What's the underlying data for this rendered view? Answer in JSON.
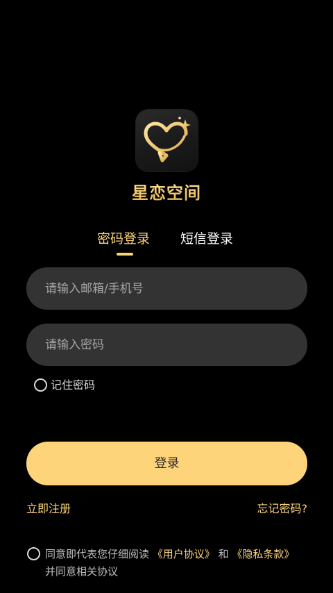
{
  "app": {
    "name": "星恋空间",
    "logo_icon": "heart-star-icon"
  },
  "tabs": [
    {
      "label": "密码登录",
      "active": true
    },
    {
      "label": "短信登录",
      "active": false
    }
  ],
  "form": {
    "account_placeholder": "请输入邮箱/手机号",
    "password_placeholder": "请输入密码",
    "remember_label": "记住密码",
    "remember_checked": false
  },
  "actions": {
    "login_label": "登录",
    "register_label": "立即注册",
    "forgot_label": "忘记密码?"
  },
  "agreement": {
    "checked": false,
    "prefix": "同意即代表您仔细阅读",
    "user_agreement": "《用户协议》",
    "conjunction": "和",
    "privacy_policy": "《隐私条款》",
    "suffix": "并同意相关协议"
  },
  "colors": {
    "accent": "#fdd47a",
    "background": "#000000",
    "field_background": "#333333",
    "placeholder": "#a6a6a6"
  }
}
